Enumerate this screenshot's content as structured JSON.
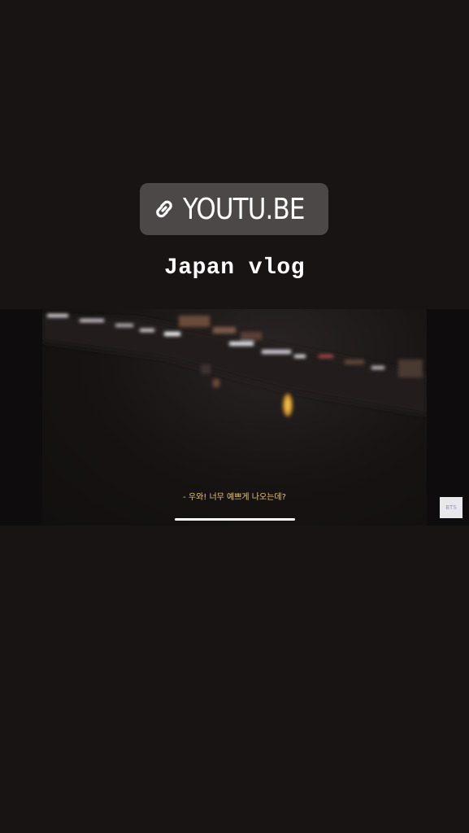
{
  "link_sticker": {
    "icon": "link-icon",
    "label": "YOUTU.BE"
  },
  "caption": "Japan vlog",
  "video": {
    "subtitle": "- 우와! 너무 예쁘게 나오는데?",
    "watermark": "BTS"
  },
  "colors": {
    "background": "#181414",
    "sticker_background": "#4d4848",
    "subtitle": "#e8c77a",
    "progress": "#ffffff"
  }
}
